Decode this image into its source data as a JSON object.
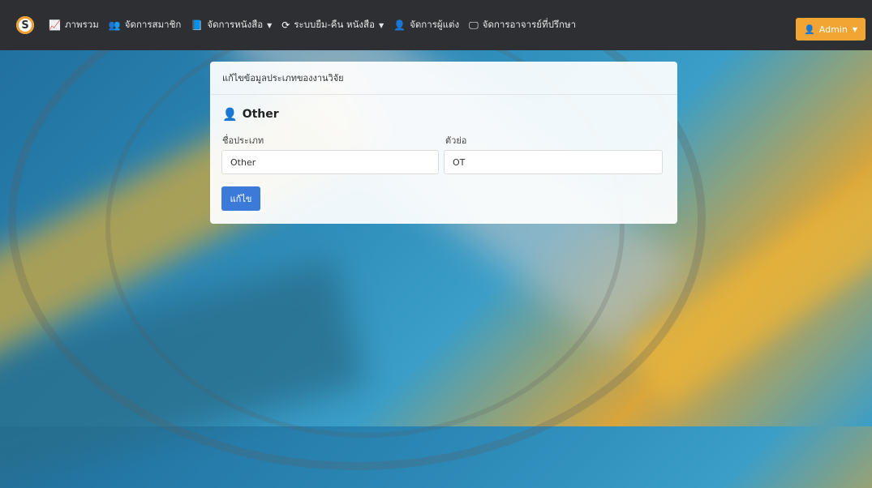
{
  "navbar": {
    "brand_letter": "S",
    "items": [
      {
        "icon": "chart-line-icon",
        "glyph": "📈",
        "label": "ภาพรวม",
        "caret": false
      },
      {
        "icon": "users-icon",
        "glyph": "👥",
        "label": "จัดการสมาชิก",
        "caret": false
      },
      {
        "icon": "book-icon",
        "glyph": "📘",
        "label": "จัดการหนังสือ",
        "caret": true
      },
      {
        "icon": "refresh-icon",
        "glyph": "⟳",
        "label": "ระบบยืม-คืน หนังสือ",
        "caret": true
      },
      {
        "icon": "user-tie-icon",
        "glyph": "👤",
        "label": "จัดการผู้แต่ง",
        "caret": false
      },
      {
        "icon": "teacher-icon",
        "glyph": "🖵",
        "label": "จัดการอาจารย์ที่ปรึกษา",
        "caret": false
      }
    ],
    "admin_label": "Admin"
  },
  "card": {
    "header": "แก้ไขข้อมูลประเภทของงานวิจัย",
    "title": "Other",
    "type_name_label": "ชื่อประเภท",
    "type_name_value": "Other",
    "abbr_label": "ตัวย่อ",
    "abbr_value": "OT",
    "submit_label": "แก้ไข"
  },
  "colors": {
    "navbar": "#2e2f33",
    "admin_button": "#f2a533",
    "submit_button": "#3b7ad9"
  }
}
